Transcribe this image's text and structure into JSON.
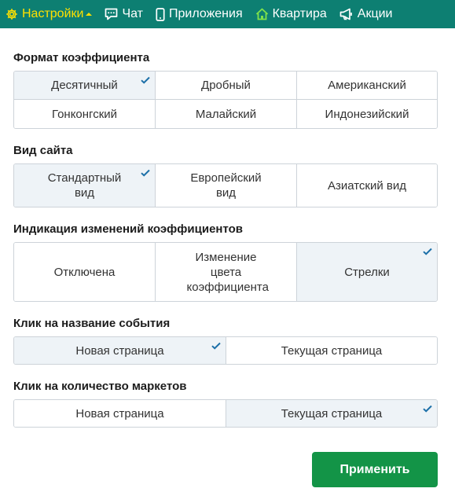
{
  "nav": {
    "items": [
      {
        "label": "Настройки",
        "icon": "gear-icon",
        "active": true
      },
      {
        "label": "Чат",
        "icon": "chat-icon"
      },
      {
        "label": "Приложения",
        "icon": "phone-icon"
      },
      {
        "label": "Квартира",
        "icon": "home-icon"
      },
      {
        "label": "Акции",
        "icon": "megaphone-icon"
      }
    ]
  },
  "sections": {
    "odds_format": {
      "title": "Формат коэффициента",
      "options": [
        "Десятичный",
        "Дробный",
        "Американский",
        "Гонконгский",
        "Малайский",
        "Индонезийский"
      ],
      "selected": 0
    },
    "site_view": {
      "title": "Вид сайта",
      "options": [
        "Стандартный вид",
        "Европейский вид",
        "Азиатский вид"
      ],
      "selected": 0
    },
    "odds_change": {
      "title": "Индикация изменений коэффициентов",
      "options": [
        "Отключена",
        "Изменение цвета коэффициента",
        "Стрелки"
      ],
      "selected": 2
    },
    "event_click": {
      "title": "Клик на название события",
      "options": [
        "Новая страница",
        "Текущая страница"
      ],
      "selected": 0
    },
    "markets_click": {
      "title": "Клик на количество маркетов",
      "options": [
        "Новая страница",
        "Текущая страница"
      ],
      "selected": 1
    }
  },
  "apply_label": "Применить",
  "colors": {
    "topbar": "#0d7f72",
    "active_nav": "#ffe000",
    "selected_bg": "#eef3f7",
    "check": "#1b6fa8",
    "apply": "#139447"
  }
}
